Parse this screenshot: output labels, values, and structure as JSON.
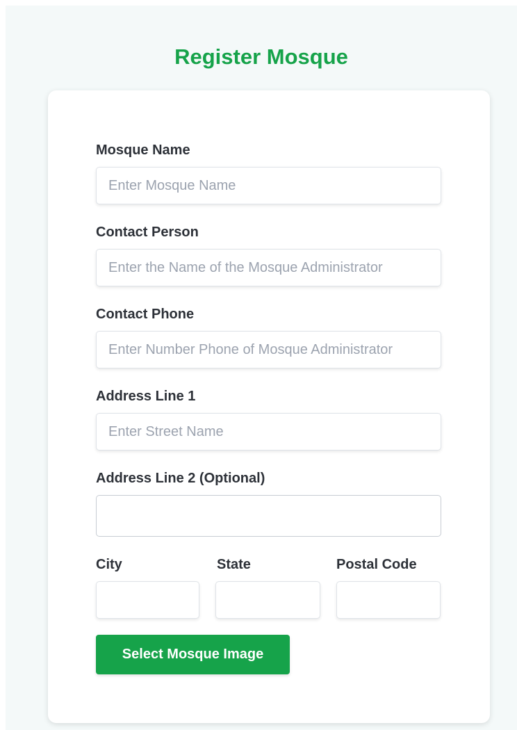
{
  "page": {
    "title": "Register Mosque"
  },
  "form": {
    "mosque_name": {
      "label": "Mosque Name",
      "placeholder": "Enter Mosque Name",
      "value": ""
    },
    "contact_person": {
      "label": "Contact Person",
      "placeholder": "Enter the Name of the Mosque Administrator",
      "value": ""
    },
    "contact_phone": {
      "label": "Contact Phone",
      "placeholder": "Enter Number Phone of Mosque Administrator",
      "value": ""
    },
    "address_line_1": {
      "label": "Address Line 1",
      "placeholder": "Enter Street Name",
      "value": ""
    },
    "address_line_2": {
      "label": "Address Line 2 (Optional)",
      "value": ""
    },
    "city": {
      "label": "City",
      "value": ""
    },
    "state": {
      "label": "State",
      "value": ""
    },
    "postal_code": {
      "label": "Postal Code",
      "value": ""
    },
    "select_image_button": "Select Mosque Image"
  },
  "colors": {
    "accent": "#16a34a",
    "background": "#f4f9f9",
    "card": "#ffffff",
    "label_text": "#2d3138",
    "placeholder_text": "#9ca3af"
  }
}
